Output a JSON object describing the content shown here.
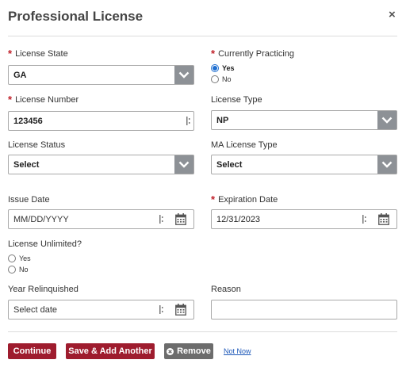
{
  "modal": {
    "title": "Professional License",
    "close_label": "×"
  },
  "fields": {
    "license_state": {
      "label": "License State",
      "required": "*",
      "value": "GA"
    },
    "currently_practicing": {
      "label": "Currently Practicing",
      "required": "*",
      "options": [
        {
          "label": "Yes",
          "checked": true
        },
        {
          "label": "No",
          "checked": false
        }
      ]
    },
    "license_number": {
      "label": "License Number",
      "required": "*",
      "value": "123456"
    },
    "license_type": {
      "label": "License Type",
      "value": "NP"
    },
    "license_status": {
      "label": "License Status",
      "value": "Select"
    },
    "ma_license_type": {
      "label": "MA License Type",
      "value": "Select"
    },
    "issue_date": {
      "label": "Issue Date",
      "placeholder": "MM/DD/YYYY"
    },
    "expiration_date": {
      "label": "Expiration Date",
      "required": "*",
      "value": "12/31/2023"
    },
    "license_unlimited": {
      "label": "License Unlimited?",
      "options": [
        {
          "label": "Yes",
          "checked": false
        },
        {
          "label": "No",
          "checked": false
        }
      ]
    },
    "year_relinquished": {
      "label": "Year Relinquished",
      "placeholder": "Select date"
    },
    "reason": {
      "label": "Reason",
      "value": ""
    }
  },
  "actions": {
    "continue": "Continue",
    "save_add": "Save & Add Another",
    "remove": "Remove",
    "not_now": "Not Now"
  },
  "icons": {
    "dropdown": "chevron-down-icon",
    "calendar": "calendar-icon",
    "field_grip": "grip-icon",
    "remove": "remove-circle-icon"
  },
  "colors": {
    "primary_button": "#9e1c2e",
    "remove_button": "#6c6c6c",
    "required_marker": "#c0202a",
    "link": "#1a56b8",
    "dropdown_caret_bg": "#8d9196"
  }
}
